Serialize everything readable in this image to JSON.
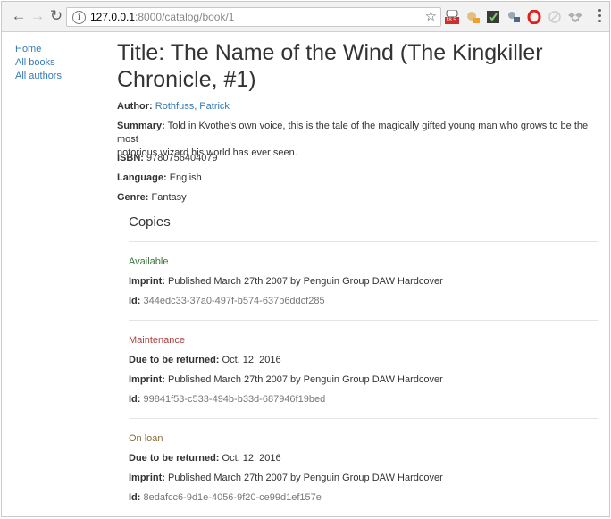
{
  "browser": {
    "url_host": "127.0.0.1",
    "url_path": ":8000/catalog/book/1",
    "badge_count": "18.5"
  },
  "sidebar": {
    "items": [
      {
        "label": "Home"
      },
      {
        "label": "All books"
      },
      {
        "label": "All authors"
      }
    ]
  },
  "book": {
    "title_line1": "Title: The Name of the Wind (The Kingkiller",
    "title_line2": "Chronicle, #1)",
    "author_label": "Author:",
    "author": "Rothfuss, Patrick",
    "summary_label": "Summary:",
    "summary_line1": "Told in Kvothe's own voice, this is the tale of the magically gifted young man who grows to be the most",
    "summary_line2": "notorious wizard his world has ever seen.",
    "isbn_label": "ISBN:",
    "isbn": "9780756404079",
    "language_label": "Language:",
    "language": "English",
    "genre_label": "Genre:",
    "genre": "Fantasy"
  },
  "copies": {
    "heading": "Copies",
    "due_label": "Due to be returned:",
    "imprint_label": "Imprint:",
    "id_label": "Id:",
    "items": [
      {
        "status": "Available",
        "due": "",
        "imprint": "Published March 27th 2007 by Penguin Group DAW Hardcover",
        "id": "344edc33-37a0-497f-b574-637b6ddcf285"
      },
      {
        "status": "Maintenance",
        "due": "Oct. 12, 2016",
        "imprint": "Published March 27th 2007 by Penguin Group DAW Hardcover",
        "id": "99841f53-c533-494b-b33d-687946f19bed"
      },
      {
        "status": "On loan",
        "due": "Oct. 12, 2016",
        "imprint": "Published March 27th 2007 by Penguin Group DAW Hardcover",
        "id": "8edafcc6-9d1e-4056-9f20-ce99d1ef157e"
      }
    ]
  },
  "colors": {
    "link": "#337ab7",
    "available": "#3c763d",
    "maintenance": "#a94442",
    "on_loan": "#8a6d3b"
  }
}
